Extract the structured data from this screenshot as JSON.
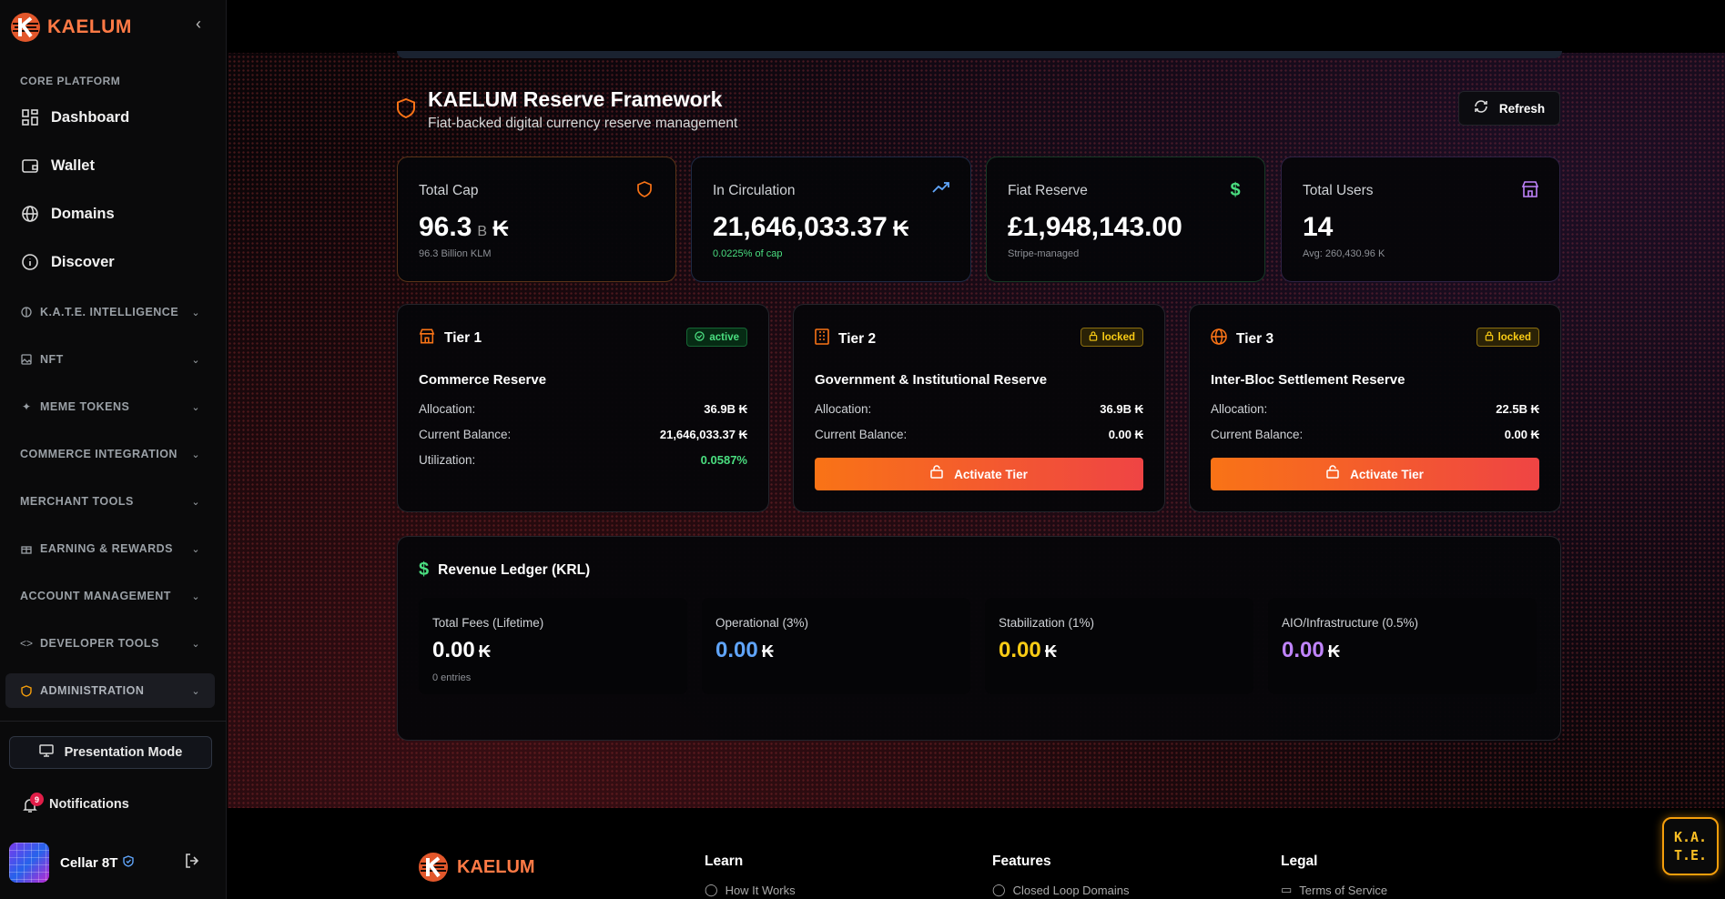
{
  "brand": {
    "name": "KAELUM"
  },
  "sidebar": {
    "section_label": "CORE PLATFORM",
    "nav": [
      {
        "label": "Dashboard",
        "icon": "grid-icon"
      },
      {
        "label": "Wallet",
        "icon": "wallet-icon"
      },
      {
        "label": "Domains",
        "icon": "globe-icon"
      },
      {
        "label": "Discover",
        "icon": "info-icon"
      }
    ],
    "groups": [
      {
        "label": "K.A.T.E. INTELLIGENCE",
        "icon": "brain-icon"
      },
      {
        "label": "NFT",
        "icon": "image-icon"
      },
      {
        "label": "MEME TOKENS",
        "icon": "sparkle-icon"
      },
      {
        "label": "COMMERCE INTEGRATION",
        "icon": ""
      },
      {
        "label": "MERCHANT TOOLS",
        "icon": ""
      },
      {
        "label": "EARNING & REWARDS",
        "icon": "gift-icon"
      },
      {
        "label": "ACCOUNT MANAGEMENT",
        "icon": ""
      },
      {
        "label": "DEVELOPER TOOLS",
        "icon": "code-icon"
      },
      {
        "label": "ADMINISTRATION",
        "icon": "shield-icon"
      }
    ],
    "presentation_label": "Presentation Mode",
    "notifications_label": "Notifications",
    "notifications_count": "9",
    "user_name": "Cellar 8T"
  },
  "header": {
    "title": "KAELUM Reserve Framework",
    "subtitle": "Fiat-backed digital currency reserve management",
    "refresh_label": "Refresh"
  },
  "stats": {
    "total_cap": {
      "label": "Total Cap",
      "value": "96.3",
      "unit": "B",
      "currency": "₭",
      "sub": "96.3 Billion KLM"
    },
    "circulation": {
      "label": "In Circulation",
      "value": "21,646,033.37",
      "currency": "₭",
      "sub": "0.0225% of cap"
    },
    "fiat": {
      "label": "Fiat Reserve",
      "value": "£1,948,143.00",
      "sub": "Stripe-managed"
    },
    "users": {
      "label": "Total Users",
      "value": "14",
      "sub": "Avg: 260,430.96 K"
    }
  },
  "tiers": [
    {
      "title": "Tier 1",
      "status": "active",
      "name": "Commerce Reserve",
      "allocation_label": "Allocation:",
      "allocation": "36.9B ₭",
      "balance_label": "Current Balance:",
      "balance": "21,646,033.37 ₭",
      "util_label": "Utilization:",
      "util": "0.0587%"
    },
    {
      "title": "Tier 2",
      "status": "locked",
      "name": "Government & Institutional Reserve",
      "allocation_label": "Allocation:",
      "allocation": "36.9B ₭",
      "balance_label": "Current Balance:",
      "balance": "0.00 ₭",
      "action": "Activate Tier"
    },
    {
      "title": "Tier 3",
      "status": "locked",
      "name": "Inter-Bloc Settlement Reserve",
      "allocation_label": "Allocation:",
      "allocation": "22.5B ₭",
      "balance_label": "Current Balance:",
      "balance": "0.00 ₭",
      "action": "Activate Tier"
    }
  ],
  "ledger": {
    "title": "Revenue Ledger (KRL)",
    "cells": [
      {
        "label": "Total Fees (Lifetime)",
        "value": "0.00",
        "currency": "₭",
        "sub": "0 entries",
        "color": "#ffffff"
      },
      {
        "label": "Operational (3%)",
        "value": "0.00",
        "currency": "₭",
        "color": "#60a5fa"
      },
      {
        "label": "Stabilization (1%)",
        "value": "0.00",
        "currency": "₭",
        "color": "#facc15"
      },
      {
        "label": "AIO/Infrastructure (0.5%)",
        "value": "0.00",
        "currency": "₭",
        "color": "#c084fc"
      }
    ]
  },
  "footer": {
    "brand": "KAELUM",
    "cols": [
      {
        "heading": "Learn",
        "link": "How It Works"
      },
      {
        "heading": "Features",
        "link": "Closed Loop Domains"
      },
      {
        "heading": "Legal",
        "link": "Terms of Service"
      }
    ],
    "kate_line1": "K.A.",
    "kate_line2": "T.E."
  },
  "colors": {
    "accent": "#f97316",
    "active": "#4ade80",
    "locked": "#facc15",
    "operational": "#60a5fa",
    "stabilization": "#facc15",
    "aio": "#c084fc"
  }
}
